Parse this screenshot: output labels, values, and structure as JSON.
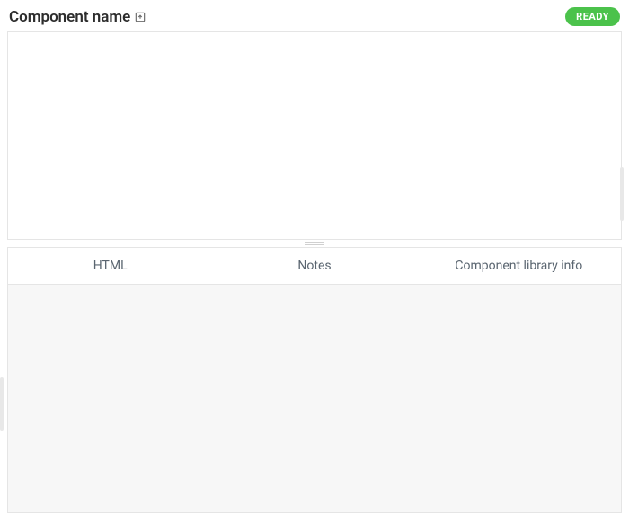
{
  "header": {
    "title": "Component name",
    "open_icon": "open-in-new-icon",
    "status_label": "READY"
  },
  "tabs": {
    "items": [
      {
        "label": "HTML"
      },
      {
        "label": "Notes"
      },
      {
        "label": "Component library info"
      }
    ]
  }
}
